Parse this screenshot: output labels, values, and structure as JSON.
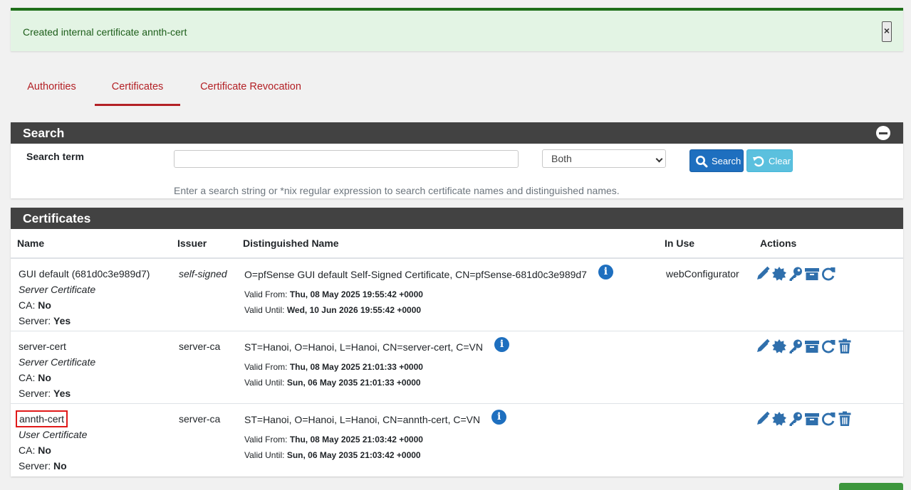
{
  "alert": {
    "message": "Created internal certificate annth-cert",
    "close": "×"
  },
  "tabs": [
    {
      "label": "Authorities",
      "active": false
    },
    {
      "label": "Certificates",
      "active": true
    },
    {
      "label": "Certificate Revocation",
      "active": false
    }
  ],
  "search_panel": {
    "title": "Search",
    "term_label": "Search term",
    "term_value": "",
    "scope_selected": "Both",
    "search_button": "Search",
    "clear_button": "Clear",
    "help": "Enter a search string or *nix regular expression to search certificate names and distinguished names."
  },
  "certificates_panel": {
    "title": "Certificates",
    "columns": [
      "Name",
      "Issuer",
      "Distinguished Name",
      "In Use",
      "Actions"
    ],
    "rows": [
      {
        "name": "GUI default (681d0c3e989d7)",
        "type": "Server Certificate",
        "ca_label": "CA:",
        "ca_value": "No",
        "server_label": "Server:",
        "server_value": "Yes",
        "issuer": "self-signed",
        "dn": "O=pfSense GUI default Self-Signed Certificate, CN=pfSense-681d0c3e989d7",
        "valid_from_label": "Valid From:",
        "valid_from": "Thu, 08 May 2025 19:55:42 +0000",
        "valid_until_label": "Valid Until:",
        "valid_until": "Wed, 10 Jun 2026 19:55:42 +0000",
        "in_use": "webConfigurator",
        "actions": [
          "edit-icon",
          "cert-icon",
          "key-icon",
          "archive-icon",
          "renew-icon"
        ]
      },
      {
        "name": "server-cert",
        "type": "Server Certificate",
        "ca_label": "CA:",
        "ca_value": "No",
        "server_label": "Server:",
        "server_value": "Yes",
        "issuer": "server-ca",
        "dn": "ST=Hanoi, O=Hanoi, L=Hanoi, CN=server-cert, C=VN",
        "valid_from_label": "Valid From:",
        "valid_from": "Thu, 08 May 2025 21:01:33 +0000",
        "valid_until_label": "Valid Until:",
        "valid_until": "Sun, 06 May 2035 21:01:33 +0000",
        "in_use": "",
        "actions": [
          "edit-icon",
          "cert-icon",
          "key-icon",
          "archive-icon",
          "renew-icon",
          "trash-icon"
        ]
      },
      {
        "name": "annth-cert",
        "type": "User Certificate",
        "ca_label": "CA:",
        "ca_value": "No",
        "server_label": "Server:",
        "server_value": "No",
        "issuer": "server-ca",
        "dn": "ST=Hanoi, O=Hanoi, L=Hanoi, CN=annth-cert, C=VN",
        "valid_from_label": "Valid From:",
        "valid_from": "Thu, 08 May 2025 21:03:42 +0000",
        "valid_until_label": "Valid Until:",
        "valid_until": "Sun, 06 May 2035 21:03:42 +0000",
        "in_use": "",
        "actions": [
          "edit-icon",
          "cert-icon",
          "key-icon",
          "archive-icon",
          "renew-icon",
          "trash-icon"
        ]
      }
    ]
  },
  "colors": {
    "accent": "#b32025",
    "primary": "#1e6fbf",
    "info": "#5bc0de",
    "heading": "#424242",
    "success_bg": "#e3f4e4"
  }
}
